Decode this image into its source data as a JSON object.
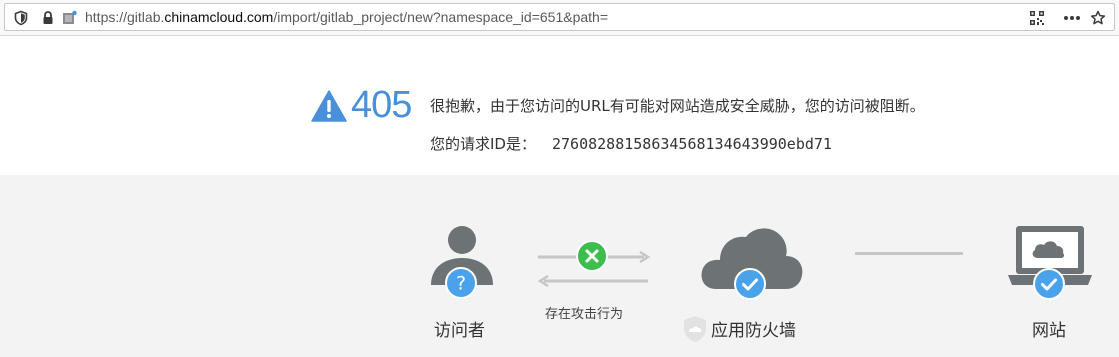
{
  "browser": {
    "url_prefix": "https://gitlab.",
    "url_host": "chinamcloud.com",
    "url_path": "/import/gitlab_project/new?namespace_id=651&path=",
    "icons": [
      "shield-icon",
      "lock-icon",
      "page-icon",
      "qr-code-icon",
      "more-icon",
      "bookmark-star-icon"
    ]
  },
  "error": {
    "code": "405",
    "message": "很抱歉，由于您访问的URL有可能对网站造成安全威胁，您的访问被阻断。",
    "request_id_label": "您的请求ID是：",
    "request_id": "27608288158634568134643990ebd71"
  },
  "diagram": {
    "visitor_label": "访问者",
    "arrow_label": "存在攻击行为",
    "firewall_label": "应用防火墙",
    "site_label": "网站"
  },
  "colors": {
    "accent_blue": "#4a90d9",
    "check_blue": "#4aa3ea",
    "error_green": "#3ebd4f",
    "icon_gray": "#6d7275",
    "diagram_bg": "#f3f3f3"
  }
}
